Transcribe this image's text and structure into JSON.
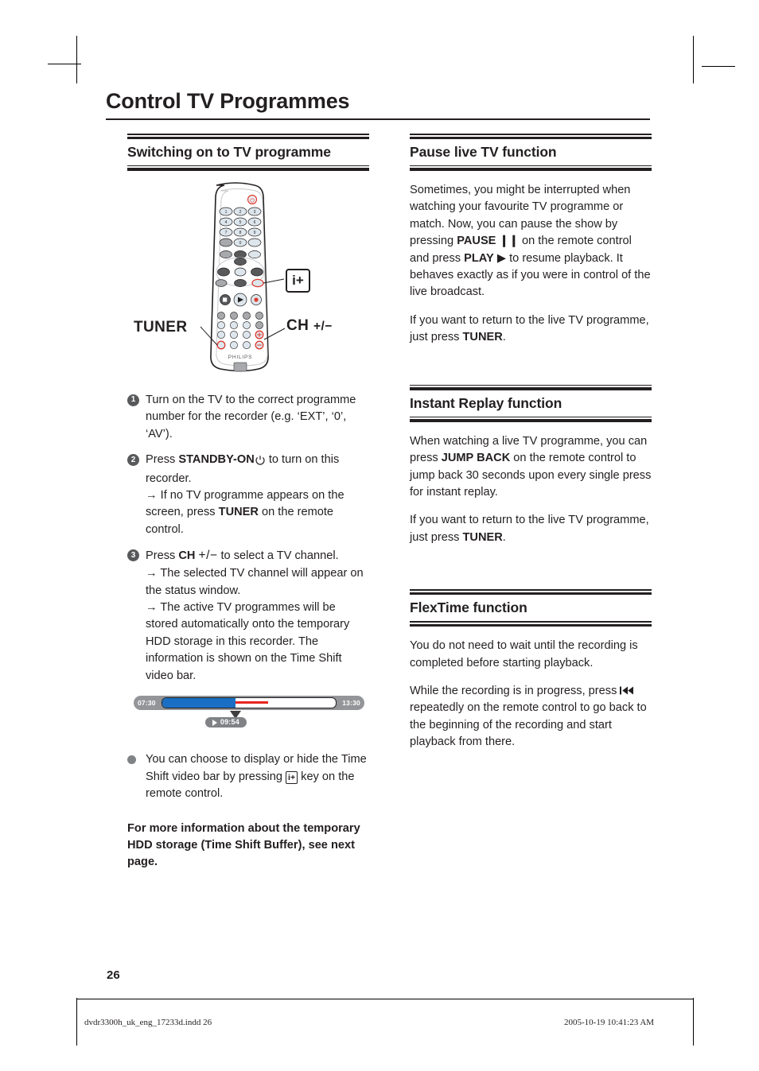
{
  "page_title": "Control TV Programmes",
  "page_number": "26",
  "left_column": {
    "section1": {
      "heading": "Switching on to TV programme",
      "figure": {
        "name": "remote-control-illustration",
        "labels": {
          "tuner": "TUNER",
          "ch": "CH",
          "ch_plusminus": "+/−",
          "info_key": "i+"
        },
        "brand": "PHILIPS",
        "keypad": [
          "1",
          "2",
          "3",
          "4",
          "5",
          "6",
          "7",
          "8",
          "9",
          "0"
        ]
      },
      "steps": [
        {
          "num": "1",
          "text": "Turn on the TV to the correct programme number for the recorder (e.g. ‘EXT’, ‘0’, ‘AV’)."
        },
        {
          "num": "2",
          "text_before": "Press ",
          "bold": "STANDBY-ON",
          "text_after": " to turn on this recorder.",
          "sub1_before": "→ If no TV programme appears on the screen, press ",
          "sub1_bold": "TUNER",
          "sub1_after": " on the remote control."
        },
        {
          "num": "3",
          "text_before": "Press ",
          "bold": "CH",
          "plusminus": "+/−",
          "text_after": " to select a TV channel.",
          "sub1": "→ The selected TV channel will appear on the status window.",
          "sub2": "→ The active TV programmes will be stored automatically onto the temporary HDD storage in this recorder. The information is shown on the Time Shift video bar."
        }
      ],
      "timeshift_bar": {
        "start_time": "07:30",
        "end_time": "13:30",
        "current_time": "09:54",
        "blue_pct": 42,
        "red_start_pct": 42,
        "red_end_pct": 61,
        "marker_pct": 42,
        "blue_color": "#1a6fc4",
        "red_color": "#e8231f",
        "bar_color": "#939598",
        "bubble_color": "#808285"
      },
      "bullet": {
        "before": "You can choose to display or hide the Time Shift video bar by pressing ",
        "key": "i+",
        "after": " key on the remote control."
      },
      "note": "For more information about the temporary HDD storage (Time Shift Buffer), see next page."
    }
  },
  "right_column": {
    "section1": {
      "heading": "Pause live TV function",
      "paragraph1": {
        "p1": "Sometimes, you might be interrupted when watching your favourite TV programme or match. Now, you can pause the show by pressing ",
        "b1": "PAUSE",
        "pause_glyph": "❙❙",
        "p2": " on the remote control and press ",
        "b2": "PLAY",
        "play_glyph": "▶",
        "p3": " to resume playback. It behaves exactly as if you were in control of the live broadcast."
      },
      "paragraph2": {
        "p1": "If you want to return to the live TV programme, just press ",
        "b1": "TUNER",
        "p2": "."
      }
    },
    "section2": {
      "heading": "Instant Replay function",
      "paragraph1": {
        "p1": "When watching a live TV programme, you can press ",
        "b1": "JUMP BACK",
        "p2": " on the remote control to jump back 30 seconds upon every single press for instant replay."
      },
      "paragraph2": {
        "p1": "If you want to return to the live TV programme, just press ",
        "b1": "TUNER",
        "p2": "."
      }
    },
    "section3": {
      "heading": "FlexTime function",
      "paragraph1": "You do not need to wait until the recording is completed before starting playback.",
      "paragraph2": {
        "p1": "While the recording is in progress, press ",
        "glyph": "⏮",
        "p2": " repeatedly on the remote control to go back to the beginning of the recording and start playback from there."
      }
    }
  },
  "footer": {
    "file": "dvdr3300h_uk_eng_17233d.indd   26",
    "timestamp": "2005-10-19   10:41:23 AM"
  }
}
